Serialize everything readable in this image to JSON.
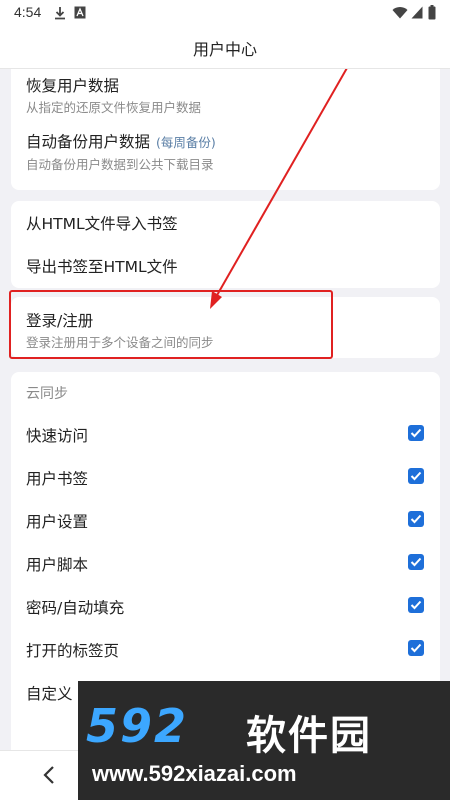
{
  "status_bar": {
    "time": "4:54"
  },
  "header": {
    "title": "用户中心"
  },
  "backup_card": {
    "restore": {
      "title": "恢复用户数据",
      "subtitle": "从指定的还原文件恢复用户数据"
    },
    "auto_backup": {
      "title": "自动备份用户数据",
      "tag": "(每周备份)",
      "subtitle": "自动备份用户数据到公共下载目录"
    }
  },
  "html_card": {
    "import": {
      "title": "从HTML文件导入书签"
    },
    "export": {
      "title": "导出书签至HTML文件"
    }
  },
  "login_card": {
    "title": "登录/注册",
    "subtitle": "登录注册用于多个设备之间的同步"
  },
  "sync_card": {
    "section_title": "云同步",
    "items": [
      {
        "label": "快速访问",
        "checked": true
      },
      {
        "label": "用户书签",
        "checked": true
      },
      {
        "label": "用户设置",
        "checked": true
      },
      {
        "label": "用户脚本",
        "checked": true
      },
      {
        "label": "密码/自动填充",
        "checked": true
      },
      {
        "label": "打开的标签页",
        "checked": true
      },
      {
        "label": "自定义"
      }
    ]
  },
  "watermark": {
    "logo": "592",
    "name": "软件园",
    "url": "www.592xiazai.com"
  },
  "colors": {
    "accent": "#1e6fd9",
    "highlight": "#e02121"
  }
}
